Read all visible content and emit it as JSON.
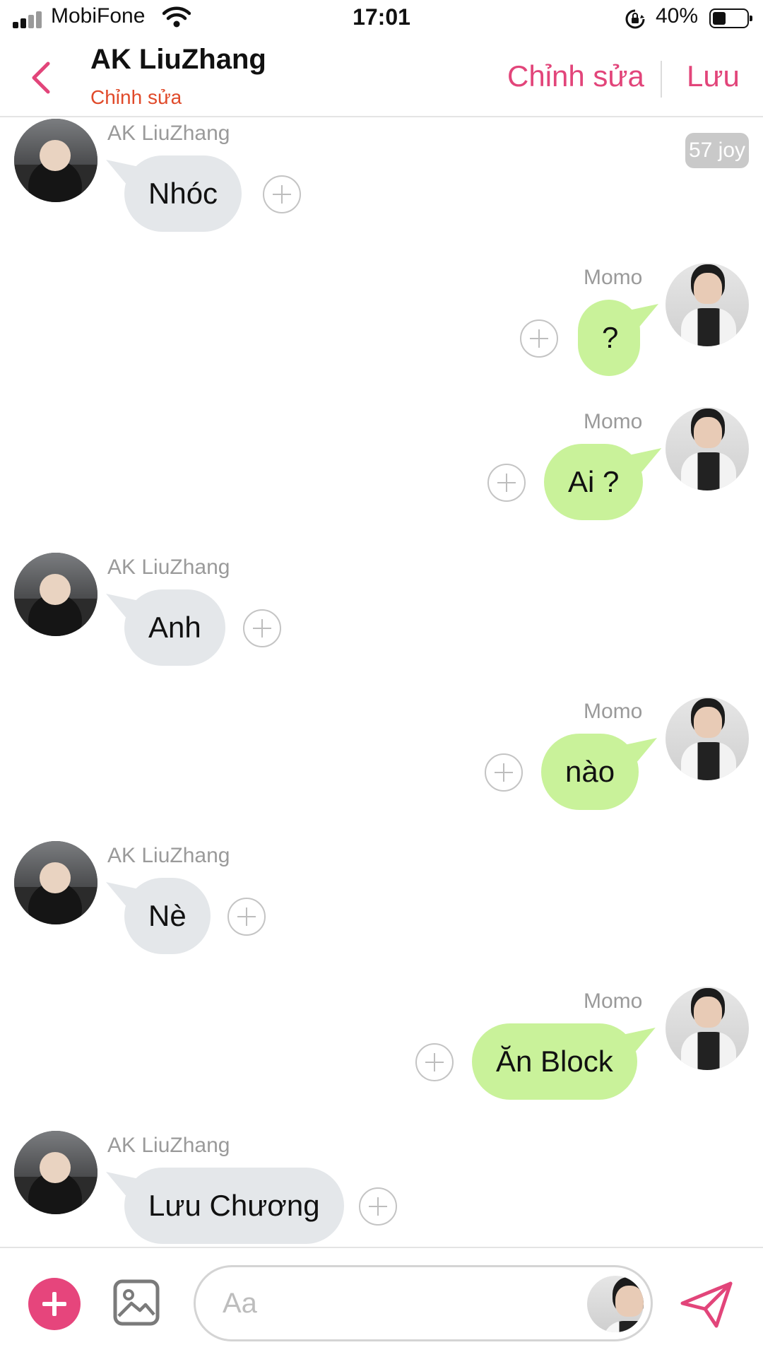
{
  "status_bar": {
    "carrier": "MobiFone",
    "time": "17:01",
    "battery": "40%",
    "battery_level": 0.4
  },
  "header": {
    "title": "AK LiuZhang",
    "subtitle": "Chỉnh sửa",
    "edit_label": "Chỉnh sửa",
    "save_label": "Lưu"
  },
  "chat": {
    "time_badge": "57 joy",
    "messages": [
      {
        "sender": "AK LiuZhang",
        "side": "left",
        "text": "Nhóc"
      },
      {
        "sender": "Momo",
        "side": "right",
        "text": "?"
      },
      {
        "sender": "Momo",
        "side": "right",
        "text": "Ai ?"
      },
      {
        "sender": "AK LiuZhang",
        "side": "left",
        "text": "Anh"
      },
      {
        "sender": "Momo",
        "side": "right",
        "text": "nào"
      },
      {
        "sender": "AK LiuZhang",
        "side": "left",
        "text": "Nè"
      },
      {
        "sender": "Momo",
        "side": "right",
        "text": "Ăn Block"
      },
      {
        "sender": "AK LiuZhang",
        "side": "left",
        "text": "Lưu Chương"
      }
    ]
  },
  "composer": {
    "placeholder": "Aa"
  },
  "colors": {
    "accent": "#e2457a",
    "subtitle": "#e04a2a",
    "bubble_in": "#e4e7ea",
    "bubble_out": "#c9f29a"
  },
  "icons": {
    "back": "chevron-left-icon",
    "add": "plus-icon",
    "image": "image-icon",
    "send": "send-icon",
    "react": "add-reaction-icon"
  }
}
